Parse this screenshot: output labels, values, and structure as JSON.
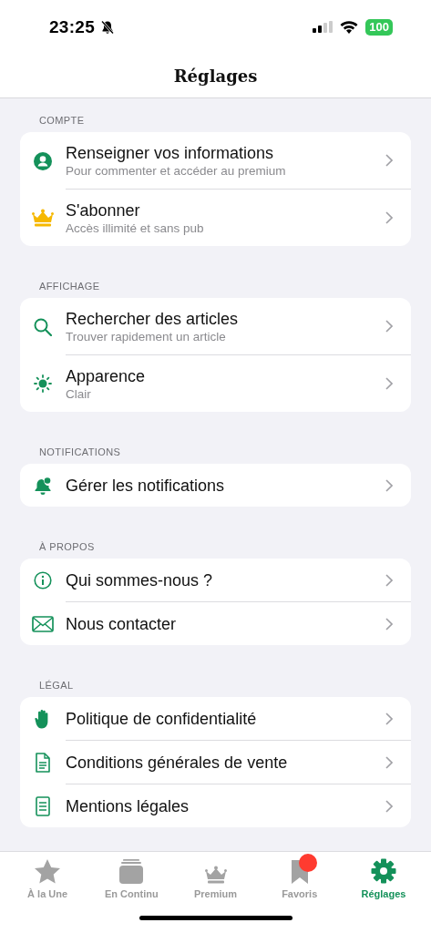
{
  "status_bar": {
    "time": "23:25",
    "silent": true,
    "battery": "100"
  },
  "title": "Réglages",
  "sections": [
    {
      "label": "COMPTE",
      "items": [
        {
          "title": "Renseigner vos informations",
          "subtitle": "Pour commenter et accéder au premium"
        },
        {
          "title": "S'abonner",
          "subtitle": "Accès illimité et sans pub"
        }
      ]
    },
    {
      "label": "AFFICHAGE",
      "items": [
        {
          "title": "Rechercher des articles",
          "subtitle": "Trouver rapidement un article"
        },
        {
          "title": "Apparence",
          "subtitle": "Clair"
        }
      ]
    },
    {
      "label": "NOTIFICATIONS",
      "items": [
        {
          "title": "Gérer les notifications"
        }
      ]
    },
    {
      "label": "À PROPOS",
      "items": [
        {
          "title": "Qui sommes-nous ?"
        },
        {
          "title": "Nous contacter"
        }
      ]
    },
    {
      "label": "LÉGAL",
      "items": [
        {
          "title": "Politique de confidentialité"
        },
        {
          "title": "Conditions générales de vente"
        },
        {
          "title": "Mentions légales"
        }
      ]
    }
  ],
  "tabs": [
    {
      "label": "À la Une",
      "selected": false,
      "badge": false
    },
    {
      "label": "En Continu",
      "selected": false,
      "badge": false
    },
    {
      "label": "Premium",
      "selected": false,
      "badge": false
    },
    {
      "label": "Favoris",
      "selected": false,
      "badge": true
    },
    {
      "label": "Réglages",
      "selected": true,
      "badge": false
    }
  ]
}
